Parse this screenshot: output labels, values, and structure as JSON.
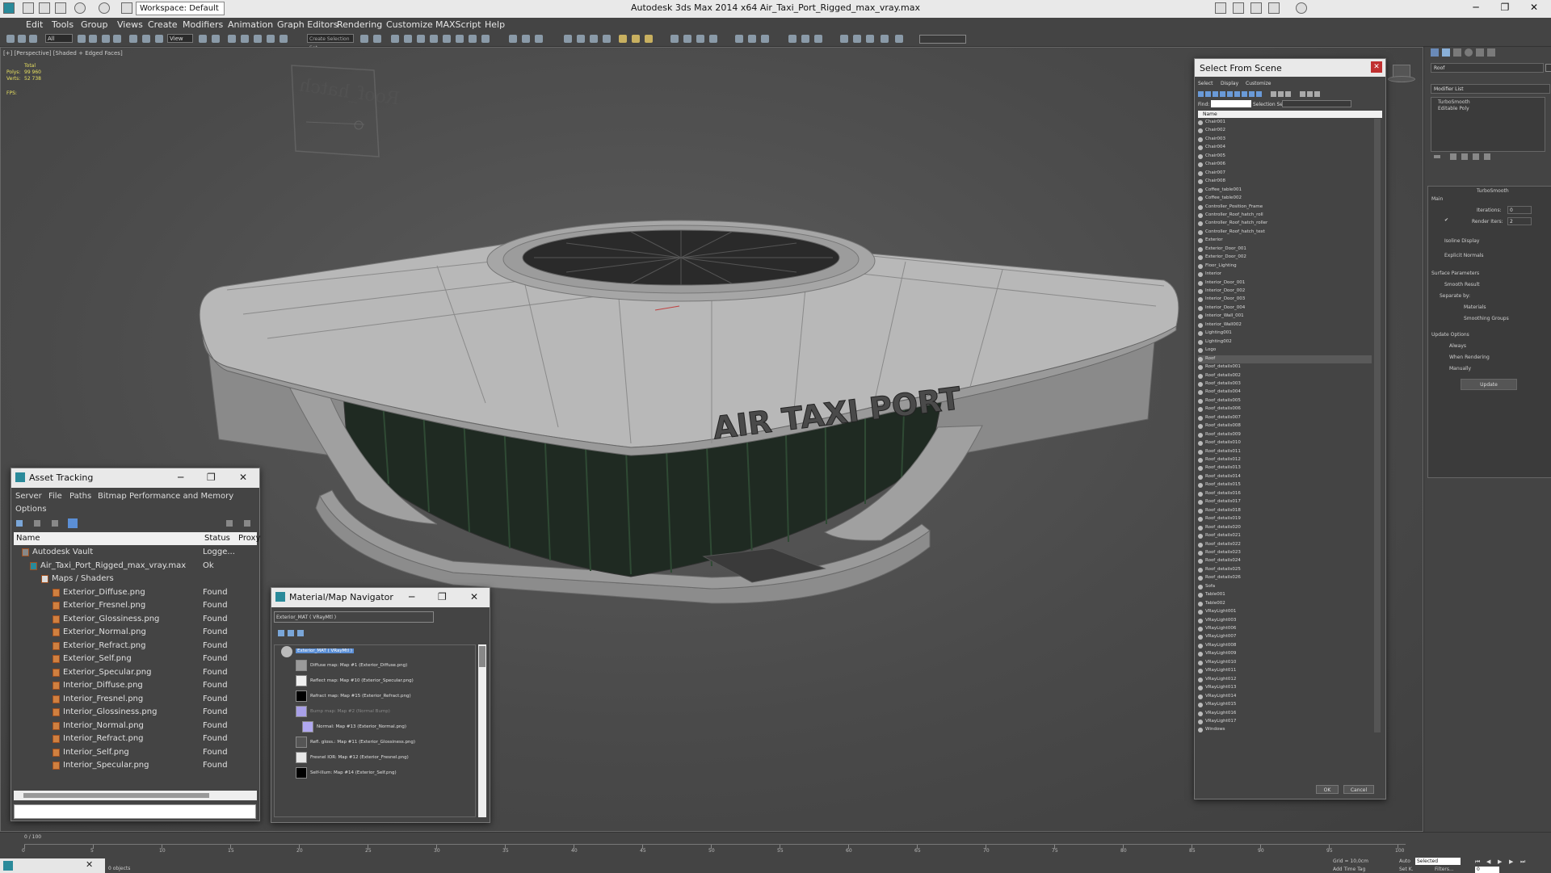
{
  "app": {
    "title": "Autodesk 3ds Max  2014 x64    Air_Taxi_Port_Rigged_max_vray.max",
    "workspace": "Workspace: Default",
    "window_buttons": [
      "─",
      "❐",
      "✕"
    ]
  },
  "menu": [
    "Edit",
    "Tools",
    "Group",
    "Views",
    "Create",
    "Modifiers",
    "Animation",
    "Graph Editors",
    "Rendering",
    "Customize",
    "MAXScript",
    "Help"
  ],
  "toolbar": {
    "selection_filter": "All",
    "ref_coord": "View",
    "named_selection": "Create Selection Set"
  },
  "viewport": {
    "label": "[+] [Perspective] [Shaded + Edged Faces]",
    "stats": {
      "total": "Total",
      "polys_label": "Polys:",
      "polys": "99 960",
      "verts_label": "Verts:",
      "verts": "52 738",
      "fps_label": "FPS:"
    },
    "building_sign": "AIR TAXI PORT",
    "helper_label": "Roof_hatch"
  },
  "asset_tracking": {
    "title": "Asset Tracking",
    "menu": [
      "Server",
      "File",
      "Paths",
      "Bitmap Performance and Memory"
    ],
    "menu2": "Options",
    "columns": [
      "Name",
      "Status",
      "Proxy"
    ],
    "rows": [
      {
        "name": "Autodesk Vault",
        "status": "Logge...",
        "level": 0
      },
      {
        "name": "Air_Taxi_Port_Rigged_max_vray.max",
        "status": "Ok",
        "level": 1
      },
      {
        "name": "Maps / Shaders",
        "status": "",
        "level": 2
      },
      {
        "name": "Exterior_Diffuse.png",
        "status": "Found",
        "level": 3
      },
      {
        "name": "Exterior_Fresnel.png",
        "status": "Found",
        "level": 3
      },
      {
        "name": "Exterior_Glossiness.png",
        "status": "Found",
        "level": 3
      },
      {
        "name": "Exterior_Normal.png",
        "status": "Found",
        "level": 3
      },
      {
        "name": "Exterior_Refract.png",
        "status": "Found",
        "level": 3
      },
      {
        "name": "Exterior_Self.png",
        "status": "Found",
        "level": 3
      },
      {
        "name": "Exterior_Specular.png",
        "status": "Found",
        "level": 3
      },
      {
        "name": "Interior_Diffuse.png",
        "status": "Found",
        "level": 3
      },
      {
        "name": "Interior_Fresnel.png",
        "status": "Found",
        "level": 3
      },
      {
        "name": "Interior_Glossiness.png",
        "status": "Found",
        "level": 3
      },
      {
        "name": "Interior_Normal.png",
        "status": "Found",
        "level": 3
      },
      {
        "name": "Interior_Refract.png",
        "status": "Found",
        "level": 3
      },
      {
        "name": "Interior_Self.png",
        "status": "Found",
        "level": 3
      },
      {
        "name": "Interior_Specular.png",
        "status": "Found",
        "level": 3
      }
    ]
  },
  "material_navigator": {
    "title": "Material/Map Navigator",
    "current": "Exterior_MAT  ( VRayMtl )",
    "root": "Exterior_MAT  ( VRayMtl )",
    "maps": [
      {
        "label": "Diffuse map: Map #1 (Exterior_Diffuse.png)",
        "swatch": "#9a9a9a"
      },
      {
        "label": "Reflect map: Map #10 (Exterior_Specular.png)",
        "swatch": "#f0f0f0"
      },
      {
        "label": "Refract map: Map #15 (Exterior_Refract.png)",
        "swatch": "#000000"
      },
      {
        "label": "Bump map: Map #2 (Normal Bump)",
        "swatch": "#a8a0e8"
      },
      {
        "label": "Normal: Map #13 (Exterior_Normal.png)",
        "swatch": "#b0a8f0"
      },
      {
        "label": "Refl. gloss.: Map #11 (Exterior_Glossiness.png)",
        "swatch": "#555555"
      },
      {
        "label": "Fresnel IOR: Map #12 (Exterior_Fresnel.png)",
        "swatch": "#e8e8e8"
      },
      {
        "label": "Self-illum: Map #14 (Exterior_Self.png)",
        "swatch": "#000000"
      }
    ]
  },
  "select_from_scene": {
    "title": "Select From Scene",
    "menu": [
      "Select",
      "Display",
      "Customize"
    ],
    "find_label": "Find:",
    "selection_set": "Selection Set:",
    "column": "Name",
    "ok": "OK",
    "cancel": "Cancel",
    "objects": [
      "Chair001",
      "Chair002",
      "Chair003",
      "Chair004",
      "Chair005",
      "Chair006",
      "Chair007",
      "Chair008",
      "Coffee_table001",
      "Coffee_table002",
      "Controller_Position_Frame",
      "Controller_Roof_hatch_roll",
      "Controller_Roof_hatch_roller",
      "Controller_Roof_hatch_text",
      "Exterior",
      "Exterior_Door_001",
      "Exterior_Door_002",
      "Floor_Lighting",
      "Interior",
      "Interior_Door_001",
      "Interior_Door_002",
      "Interior_Door_003",
      "Interior_Door_004",
      "Interior_Wall_001",
      "Interior_Wall002",
      "Lighting001",
      "Lighting002",
      "Logo",
      "Roof",
      "Roof_details001",
      "Roof_details002",
      "Roof_details003",
      "Roof_details004",
      "Roof_details005",
      "Roof_details006",
      "Roof_details007",
      "Roof_details008",
      "Roof_details009",
      "Roof_details010",
      "Roof_details011",
      "Roof_details012",
      "Roof_details013",
      "Roof_details014",
      "Roof_details015",
      "Roof_details016",
      "Roof_details017",
      "Roof_details018",
      "Roof_details019",
      "Roof_details020",
      "Roof_details021",
      "Roof_details022",
      "Roof_details023",
      "Roof_details024",
      "Roof_details025",
      "Roof_details026",
      "Sofa",
      "Table001",
      "Table002",
      "VRayLight001",
      "VRayLight003",
      "VRayLight006",
      "VRayLight007",
      "VRayLight008",
      "VRayLight009",
      "VRayLight010",
      "VRayLight011",
      "VRayLight012",
      "VRayLight013",
      "VRayLight014",
      "VRayLight015",
      "VRayLight016",
      "VRayLight017",
      "Windows"
    ],
    "selected": "Roof"
  },
  "command_panel": {
    "object_name": "Roof",
    "modifier_list": "Modifier List",
    "stack": [
      "TurboSmooth",
      "Editable Poly"
    ],
    "rollout_title": "TurboSmooth",
    "main": "Main",
    "iterations_label": "Iterations:",
    "iterations": "0",
    "render_iters_label": "Render Iters:",
    "render_iters": "2",
    "isoline": "Isoline Display",
    "explicit": "Explicit Normals",
    "surface_params": "Surface Parameters",
    "smooth_result": "Smooth Result",
    "separate_by": "Separate by:",
    "materials": "Materials",
    "smoothing_groups": "Smoothing Groups",
    "update_options": "Update Options",
    "always": "Always",
    "when_rendering": "When Rendering",
    "manually": "Manually",
    "update_btn": "Update"
  },
  "timeline": {
    "frame": "0 / 100",
    "ticks": [
      "0",
      "5",
      "10",
      "15",
      "20",
      "25",
      "30",
      "35",
      "40",
      "45",
      "50",
      "55",
      "60",
      "65",
      "70",
      "75",
      "80",
      "85",
      "90",
      "95",
      "100"
    ],
    "status": "0 objects",
    "grid": "Grid = 10,0cm",
    "auto": "Auto",
    "selected": "Selected",
    "set_k": "Set K.",
    "filters": "Filters...",
    "add_time_tag": "Add Time Tag",
    "frame_field": "0"
  },
  "colors": {
    "accent": "#5b8fd6",
    "found": "#e0e0e0",
    "chrome": "#444444"
  }
}
